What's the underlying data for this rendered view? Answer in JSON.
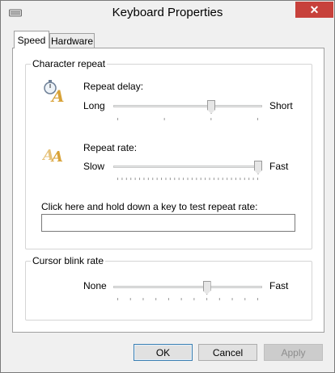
{
  "window": {
    "title": "Keyboard Properties",
    "close_glyph": "✕"
  },
  "tabs": [
    {
      "label": "Speed",
      "selected": true
    },
    {
      "label": "Hardware",
      "selected": false
    }
  ],
  "character_repeat": {
    "legend": "Character repeat",
    "delay": {
      "label": "Repeat delay:",
      "min_label": "Long",
      "max_label": "Short",
      "value_fraction": 0.667,
      "ticks": 4
    },
    "rate": {
      "label": "Repeat rate:",
      "min_label": "Slow",
      "max_label": "Fast",
      "value_fraction": 1.0,
      "ticks": 33
    },
    "test": {
      "label": "Click here and hold down a key to test repeat rate:",
      "value": ""
    }
  },
  "cursor_blink": {
    "legend": "Cursor blink rate",
    "min_label": "None",
    "max_label": "Fast",
    "value_fraction": 0.636,
    "ticks": 12
  },
  "buttons": {
    "ok": "OK",
    "cancel": "Cancel",
    "apply": "Apply"
  },
  "icons": {
    "app": "keyboard-icon",
    "delay": "stopwatch-letter-icon",
    "rate": "repeated-letters-icon"
  }
}
